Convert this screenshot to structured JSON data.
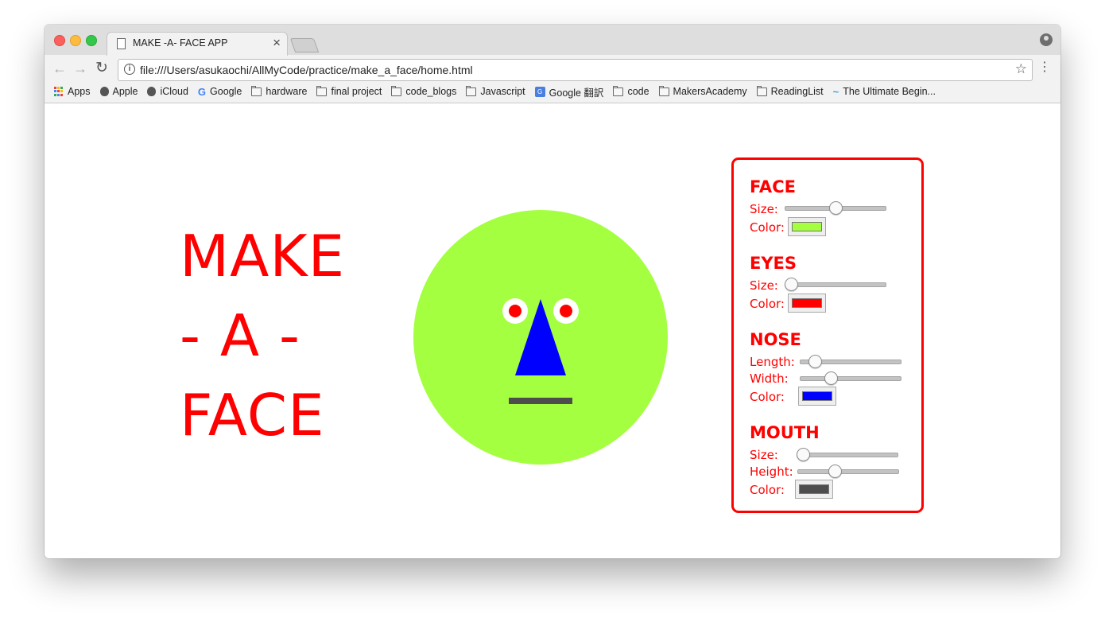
{
  "browser": {
    "tab_title": "MAKE -A- FACE APP",
    "tab_close": "×",
    "url": "file:///Users/asukaochi/AllMyCode/practice/make_a_face/home.html",
    "back_icon": "←",
    "forward_icon": "→",
    "reload_icon": "↻",
    "info_icon": "i",
    "star_icon": "☆",
    "menu_icon": "⋮"
  },
  "bookmarks": [
    {
      "label": "Apps",
      "icon": "apps-grid-icon"
    },
    {
      "label": "Apple",
      "icon": "apple-icon"
    },
    {
      "label": "iCloud",
      "icon": "apple-icon"
    },
    {
      "label": "Google",
      "icon": "google-icon"
    },
    {
      "label": "hardware",
      "icon": "folder-icon"
    },
    {
      "label": "final project",
      "icon": "folder-icon"
    },
    {
      "label": "code_blogs",
      "icon": "folder-icon"
    },
    {
      "label": "Javascript",
      "icon": "folder-icon"
    },
    {
      "label": "Google 翻訳",
      "icon": "translate-icon"
    },
    {
      "label": "code",
      "icon": "folder-icon"
    },
    {
      "label": "MakersAcademy",
      "icon": "folder-icon"
    },
    {
      "label": "ReadingList",
      "icon": "folder-icon"
    },
    {
      "label": "The Ultimate Begin...",
      "icon": "link-icon"
    }
  ],
  "page": {
    "title_lines": [
      "MAKE",
      "- A -",
      "FACE"
    ]
  },
  "face": {
    "face_color": "#a3ff3f",
    "eye_white": "#ffffff",
    "eye_color": "#ff0000",
    "nose_color": "#0000ff",
    "mouth_color": "#4d4d4d"
  },
  "controls": {
    "face": {
      "title": "FACE",
      "size_label": "Size:",
      "size_value": 0.5,
      "color_label": "Color:",
      "color": "#a3ff3f"
    },
    "eyes": {
      "title": "EYES",
      "size_label": "Size:",
      "size_value": 0.0,
      "color_label": "Color:",
      "color": "#ff0000"
    },
    "nose": {
      "title": "NOSE",
      "length_label": "Length:",
      "length_value": 0.1,
      "width_label": "Width:",
      "width_value": 0.28,
      "color_label": "Color:",
      "color": "#0000ff"
    },
    "mouth": {
      "title": "MOUTH",
      "size_label": "Size:",
      "size_value": 0.0,
      "height_label": "Height:",
      "height_value": 0.35,
      "color_label": "Color:",
      "color": "#4d4d4d"
    }
  }
}
